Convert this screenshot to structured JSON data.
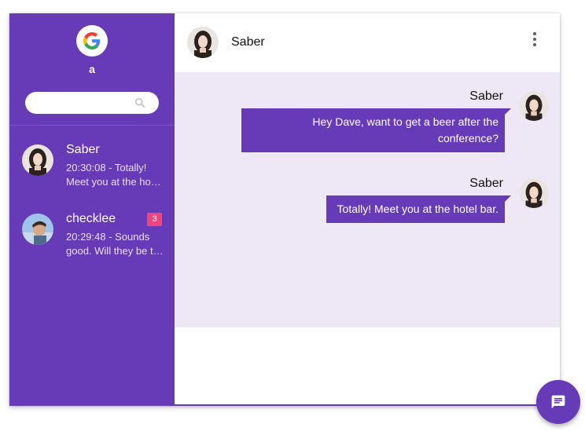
{
  "account": {
    "name": "a",
    "avatar_icon": "google-g-icon"
  },
  "search": {
    "placeholder": "",
    "value": ""
  },
  "conversations": [
    {
      "name": "Saber",
      "preview_line1": "20:30:08 - Totally!",
      "preview_line2": "Meet you at the hotel bar.",
      "unread": ""
    },
    {
      "name": "checklee",
      "preview_line1": "20:29:48 - Sounds",
      "preview_line2": "good. Will they be there?",
      "unread": "3"
    }
  ],
  "chat": {
    "title": "Saber",
    "messages": [
      {
        "sender": "Saber",
        "line1": "Hey Dave, want to get a beer after the",
        "line2": "conference?"
      },
      {
        "sender": "Saber",
        "text": "Totally! Meet you at the hotel bar."
      }
    ]
  },
  "colors": {
    "primary": "#673ab7",
    "chat_background": "#ede7f6",
    "badge": "#f0447d"
  },
  "icons": {
    "search": "search-icon",
    "menu": "more-vert-icon",
    "fab": "chat-icon"
  }
}
